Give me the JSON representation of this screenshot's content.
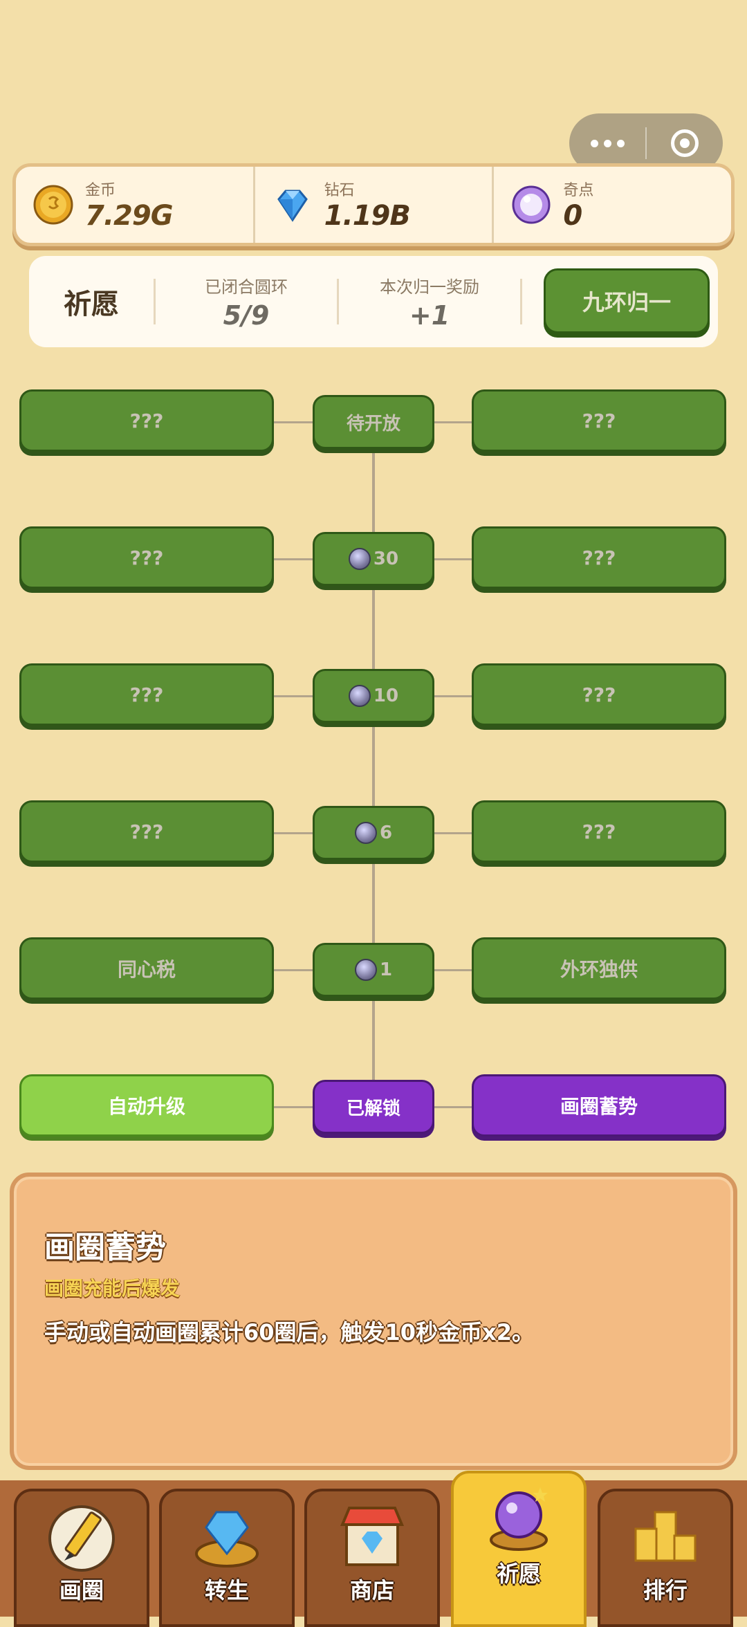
{
  "resources": [
    {
      "label": "金币",
      "value": "7.29G",
      "icon": "gold-coin-icon"
    },
    {
      "label": "钻石",
      "value": "1.19B",
      "icon": "diamond-icon"
    },
    {
      "label": "奇点",
      "value": "0",
      "icon": "singularity-orb-icon"
    }
  ],
  "wish": {
    "title": "祈愿",
    "closed_label": "已闭合圆环",
    "closed_value": "5/9",
    "reward_label": "本次归一奖励",
    "reward_value": "+1",
    "action_button": "九环归一"
  },
  "tree": {
    "rows": [
      {
        "left": "???",
        "center": "待开放",
        "center_cost": "",
        "right": "???"
      },
      {
        "left": "???",
        "center": "",
        "center_cost": "30",
        "right": "???"
      },
      {
        "left": "???",
        "center": "",
        "center_cost": "10",
        "right": "???"
      },
      {
        "left": "???",
        "center": "",
        "center_cost": "6",
        "right": "???"
      },
      {
        "left": "同心税",
        "center": "",
        "center_cost": "1",
        "right": "外环独供"
      },
      {
        "left": "自动升级",
        "center": "已解锁",
        "center_cost": "",
        "right": "画圈蓄势"
      }
    ]
  },
  "detail": {
    "title": "画圈蓄势",
    "subtitle": "画圈充能后爆发",
    "description": "手动或自动画圈累计60圈后，触发10秒金币x2。"
  },
  "nav": {
    "tabs": [
      {
        "label": "画圈",
        "icon": "pencil-icon"
      },
      {
        "label": "转生",
        "icon": "diamond-ring-icon"
      },
      {
        "label": "商店",
        "icon": "shop-icon"
      },
      {
        "label": "祈愿",
        "icon": "crystal-ball-icon",
        "active": true
      },
      {
        "label": "排行",
        "icon": "podium-icon"
      }
    ]
  }
}
